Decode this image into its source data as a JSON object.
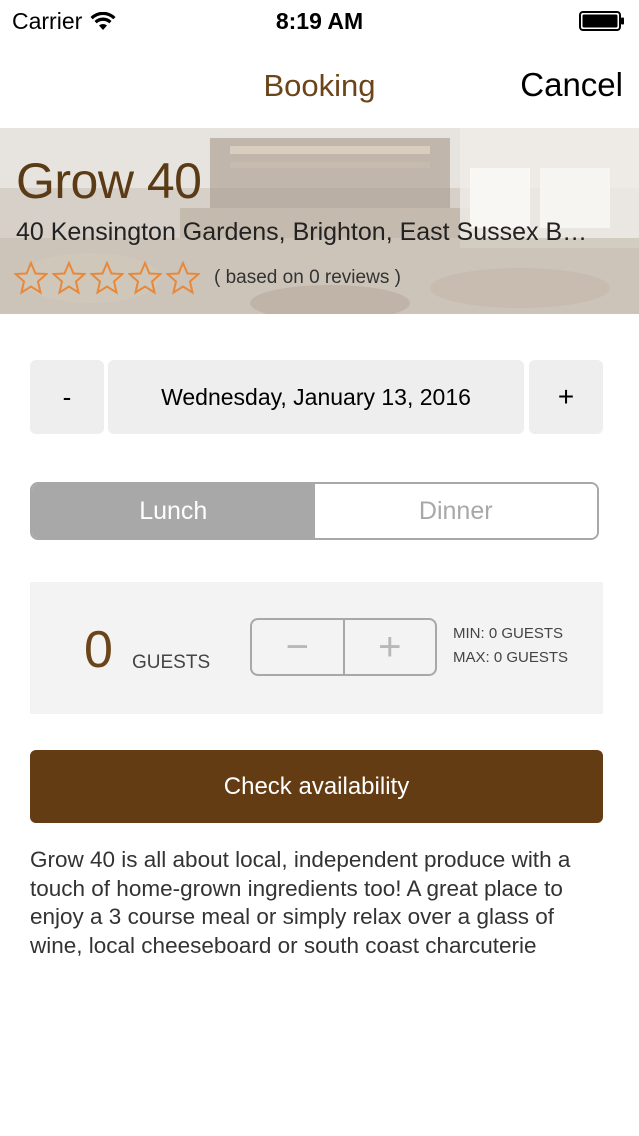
{
  "status_bar": {
    "carrier": "Carrier",
    "time": "8:19 AM"
  },
  "nav": {
    "title": "Booking",
    "cancel_label": "Cancel"
  },
  "restaurant": {
    "name": "Grow 40",
    "address": "40 Kensington Gardens, Brighton, East Sussex B…",
    "star_rating": 0,
    "star_max": 5,
    "reviews_text": "( based on 0 reviews )"
  },
  "date_picker": {
    "minus_label": "-",
    "plus_label": "+",
    "date_value": "Wednesday, January 13, 2016"
  },
  "meal_segments": {
    "options": [
      "Lunch",
      "Dinner"
    ],
    "selected": "Lunch"
  },
  "guests": {
    "count": "0",
    "label": "GUESTS",
    "min_text": "MIN: 0 GUESTS",
    "max_text": "MAX: 0 GUESTS",
    "decrement_label": "−",
    "increment_label": "+"
  },
  "cta": {
    "label": "Check availability"
  },
  "description": "Grow 40 is all about local, independent produce with a touch of home-grown ingredients too! A great place to enjoy a 3 course meal or simply relax over a glass of wine, local cheeseboard or south coast charcuterie",
  "colors": {
    "brand_brown": "#643c13",
    "title_brown": "#6b4519",
    "star_orange": "#e8883a",
    "segment_gray": "#a8a8a8"
  }
}
